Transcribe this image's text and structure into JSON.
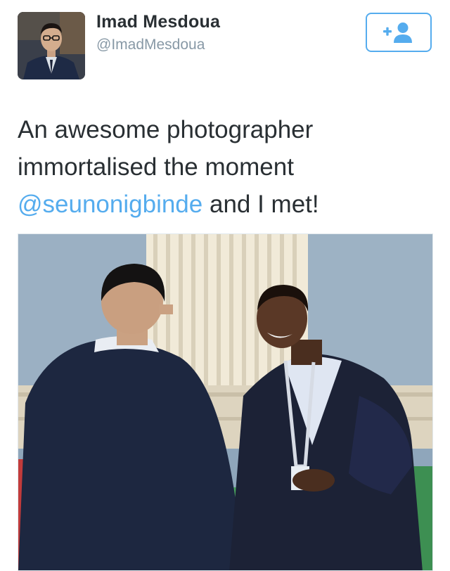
{
  "author": {
    "name": "Imad Mesdoua",
    "handle": "@ImadMesdoua",
    "avatar_icon": "profile-photo"
  },
  "follow_button": {
    "icon": "add-user-icon",
    "color": "#55acee"
  },
  "tweet": {
    "line1": "An awesome photographer",
    "line2": "immortalised the moment",
    "mention": "@seunonigbinde",
    "line3_rest": " and I met!"
  },
  "media": {
    "description_icon": "photo"
  },
  "colors": {
    "accent": "#55acee",
    "text": "#292f33",
    "secondary": "#8899a6"
  }
}
